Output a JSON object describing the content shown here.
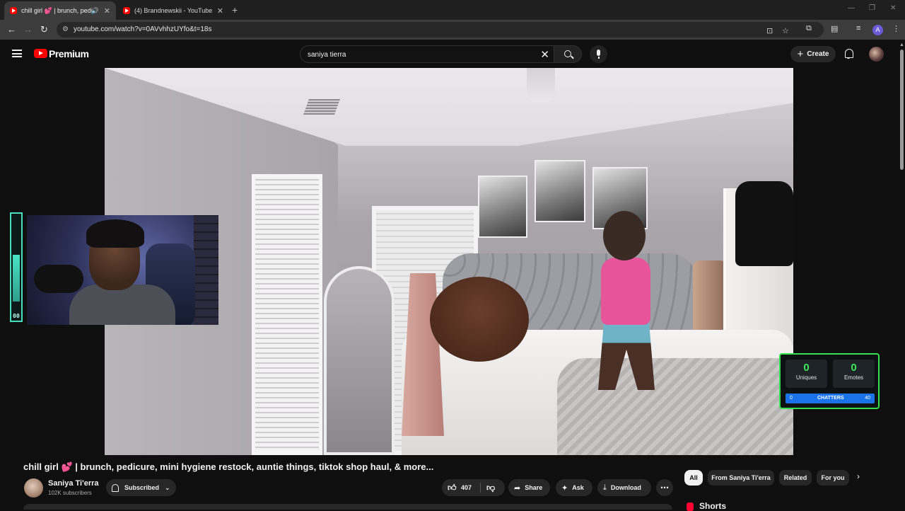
{
  "browser": {
    "tabs": [
      {
        "title": "chill girl 💕 | brunch, pedic",
        "active": true,
        "audio": true
      },
      {
        "title": "(4) Brandnewskii - YouTube",
        "active": false
      }
    ],
    "url": "youtube.com/watch?v=0AVvhhzUYfo&t=18s",
    "profile_initial": "A"
  },
  "header": {
    "brand": "Premium",
    "search_value": "saniya tierra",
    "create_label": "Create"
  },
  "overlay": {
    "meter_value": "00",
    "meter_level": 0.55,
    "stats": {
      "uniques_value": "0",
      "uniques_label": "Uniques",
      "emotes_value": "0",
      "emotes_label": "Emotes",
      "bar_min": "0",
      "bar_label": "CHATTERS",
      "bar_max": "40"
    }
  },
  "video": {
    "title": "chill girl 💕 | brunch, pedicure, mini hygiene restock, auntie things, tiktok shop haul, & more...",
    "channel": "Saniya Ti'erra",
    "subscribers": "102K subscribers",
    "subscribed_label": "Subscribed",
    "likes": "407",
    "share_label": "Share",
    "ask_label": "Ask",
    "download_label": "Download"
  },
  "sidebar": {
    "chips": [
      "All",
      "From Saniya Ti'erra",
      "Related",
      "For you"
    ],
    "shorts_label": "Shorts"
  },
  "colors": {
    "brand_red": "#ff0000",
    "overlay_green": "#35e04f",
    "chatters_blue": "#1a73e8",
    "meter_teal": "#45e0c0"
  }
}
